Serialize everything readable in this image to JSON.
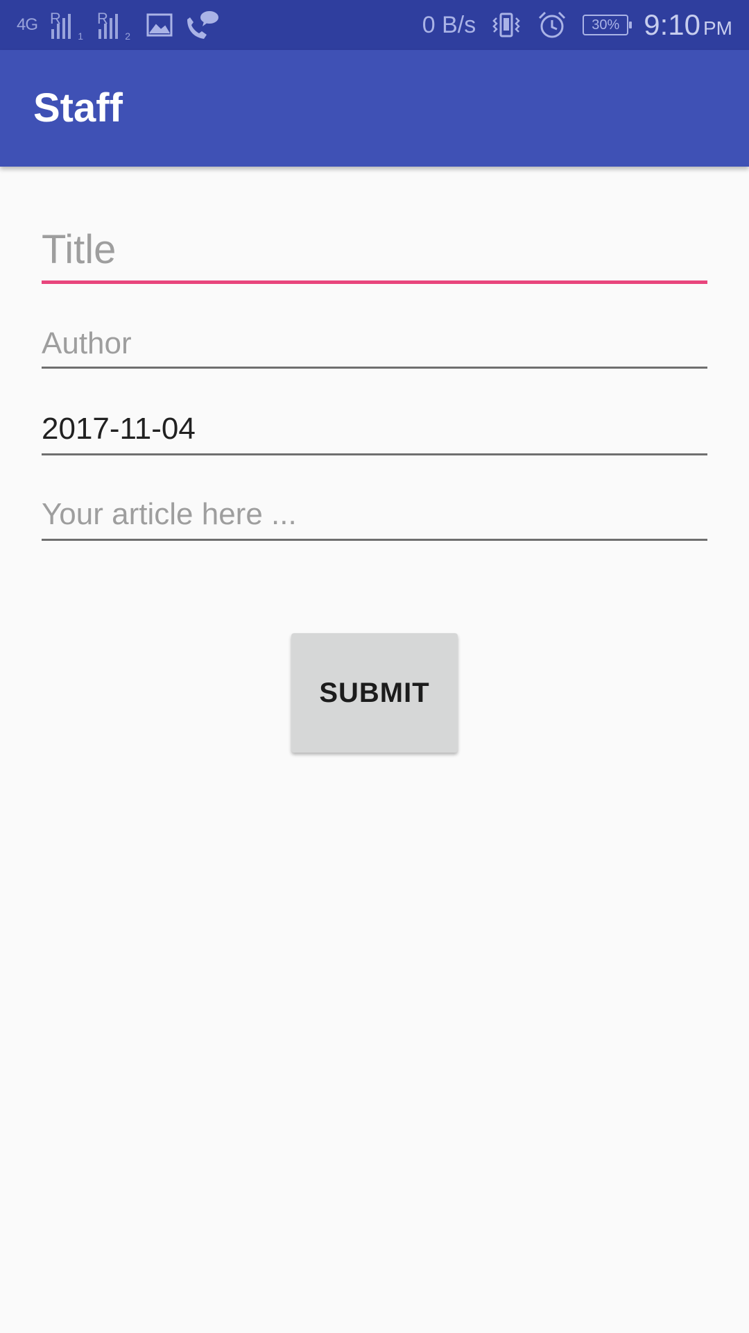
{
  "status_bar": {
    "network_type": "4G",
    "sim1_label": "R",
    "sim1_slot": "1",
    "sim2_label": "R",
    "sim2_slot": "2",
    "gallery_icon": "image-icon",
    "call_icon": "wifi-call-icon",
    "data_speed": "0 B/s",
    "vibrate_icon": "vibrate-icon",
    "alarm_icon": "alarm-icon",
    "battery": "30%",
    "time": "9:10",
    "ampm": "PM"
  },
  "app_bar": {
    "title": "Staff",
    "color": "#3f51b5",
    "status_color": "#2f3e9e"
  },
  "form": {
    "title_field": {
      "placeholder": "Title",
      "value": "",
      "focused": true
    },
    "author_field": {
      "placeholder": "Author",
      "value": ""
    },
    "date_field": {
      "value": "2017-11-04"
    },
    "article_field": {
      "placeholder": "Your article here ..."
    },
    "accent_color": "#e8457c",
    "submit_label": "SUBMIT"
  }
}
